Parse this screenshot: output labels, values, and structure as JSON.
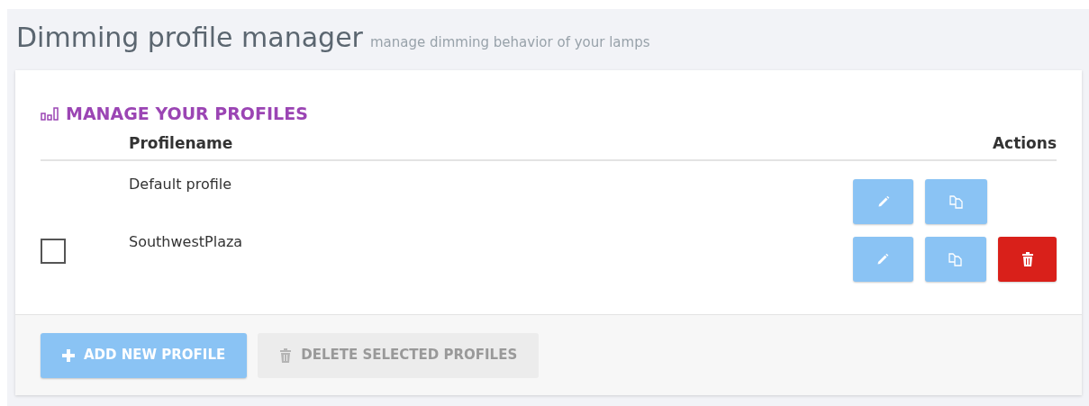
{
  "page": {
    "title": "Dimming profile manager",
    "subtitle": "manage dimming behavior of your lamps"
  },
  "panel": {
    "heading": "MANAGE YOUR PROFILES"
  },
  "table": {
    "columns": [
      "Profilename",
      "Actions"
    ],
    "rows": [
      {
        "name": "Default profile",
        "selectable": false,
        "deletable": false
      },
      {
        "name": "SouthwestPlaza",
        "selectable": true,
        "checked": false,
        "deletable": true
      }
    ]
  },
  "footer": {
    "buttons": [
      {
        "label": "ADD NEW PROFILE",
        "kind": "add",
        "disabled": false
      },
      {
        "label": "DELETE SELECTED PROFILES",
        "kind": "delete",
        "disabled": true
      }
    ]
  }
}
